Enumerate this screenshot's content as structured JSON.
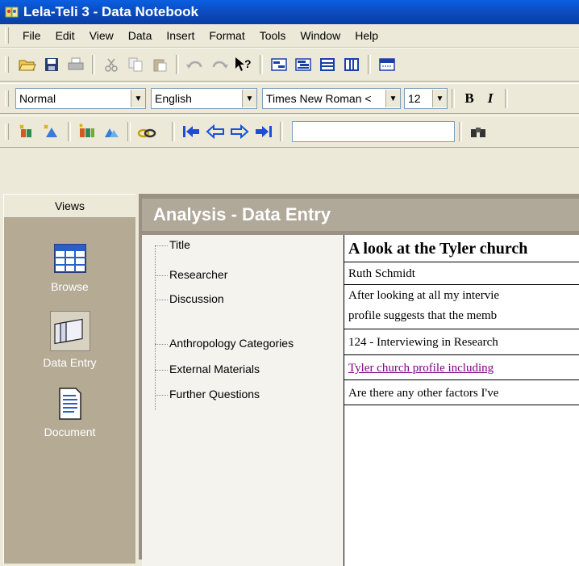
{
  "window": {
    "title": "Lela-Teli 3 - Data Notebook"
  },
  "menu": [
    {
      "label": "File"
    },
    {
      "label": "Edit"
    },
    {
      "label": "View"
    },
    {
      "label": "Data"
    },
    {
      "label": "Insert"
    },
    {
      "label": "Format"
    },
    {
      "label": "Tools"
    },
    {
      "label": "Window"
    },
    {
      "label": "Help"
    }
  ],
  "format_toolbar": {
    "style": "Normal",
    "language": "English",
    "font": "Times New Roman <",
    "size": "12",
    "bold_label": "B",
    "italic_label": "I"
  },
  "views": {
    "header": "Views",
    "items": [
      {
        "label": "Browse",
        "icon": "grid-table-icon"
      },
      {
        "label": "Data Entry",
        "icon": "stacked-cards-icon"
      },
      {
        "label": "Document",
        "icon": "document-icon"
      }
    ],
    "active": "Data Entry"
  },
  "main": {
    "title": "Analysis - Data Entry",
    "fields": [
      {
        "label": "Title",
        "value": "A look at the Tyler church"
      },
      {
        "label": "Researcher",
        "value": "Ruth Schmidt"
      },
      {
        "label": "Discussion",
        "value": "After looking at all my intervie\nprofile suggests that the memb"
      },
      {
        "label": "Anthropology Categories",
        "value": "124 - Interviewing in Research"
      },
      {
        "label": "External Materials",
        "value": "Tyler church profile including"
      },
      {
        "label": "Further Questions",
        "value": "Are there any other factors I've"
      }
    ]
  },
  "colors": {
    "titlebar": "#0b48b8",
    "views_panel": "#b5ab95",
    "section_header": "#b0a899",
    "link": "#800080"
  }
}
